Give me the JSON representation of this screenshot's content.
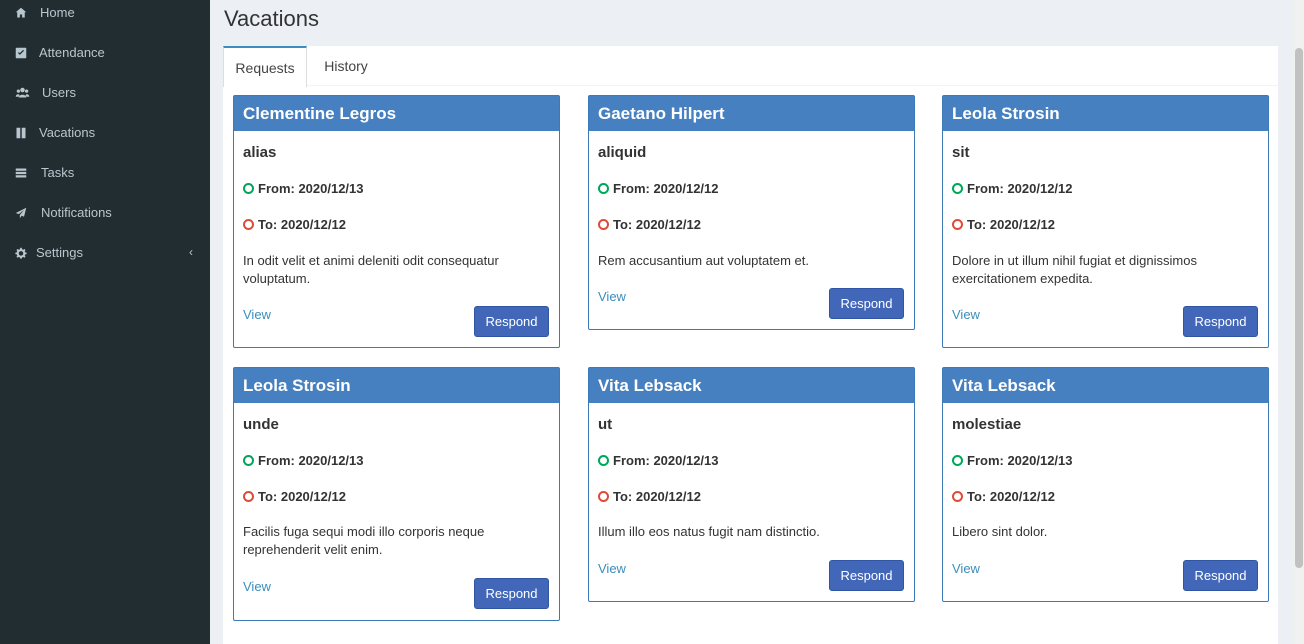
{
  "sidebar": {
    "items": [
      {
        "label": "Home",
        "icon": "home-icon"
      },
      {
        "label": "Attendance",
        "icon": "check-square-icon"
      },
      {
        "label": "Users",
        "icon": "users-icon"
      },
      {
        "label": "Vacations",
        "icon": "columns-icon"
      },
      {
        "label": "Tasks",
        "icon": "tasks-icon"
      },
      {
        "label": "Notifications",
        "icon": "paper-plane-icon"
      },
      {
        "label": "Settings",
        "icon": "gear-icon",
        "chevron": "‹"
      }
    ]
  },
  "page": {
    "title": "Vacations"
  },
  "tabs": [
    {
      "label": "Requests",
      "active": true
    },
    {
      "label": "History",
      "active": false
    }
  ],
  "cards": [
    {
      "name": "Clementine Legros",
      "subject": "alias",
      "from": "From: 2020/12/13",
      "to": "To: 2020/12/12",
      "description": "In odit velit et animi deleniti odit consequatur voluptatum.",
      "view": "View",
      "respond": "Respond"
    },
    {
      "name": "Gaetano Hilpert",
      "subject": "aliquid",
      "from": "From: 2020/12/12",
      "to": "To: 2020/12/12",
      "description": "Rem accusantium aut voluptatem et.",
      "view": "View",
      "respond": "Respond"
    },
    {
      "name": "Leola Strosin",
      "subject": "sit",
      "from": "From: 2020/12/12",
      "to": "To: 2020/12/12",
      "description": "Dolore in ut illum nihil fugiat et dignissimos exercitationem expedita.",
      "view": "View",
      "respond": "Respond"
    },
    {
      "name": "Leola Strosin",
      "subject": "unde",
      "from": "From: 2020/12/13",
      "to": "To: 2020/12/12",
      "description": "Facilis fuga sequi modi illo corporis neque reprehenderit velit enim.",
      "view": "View",
      "respond": "Respond"
    },
    {
      "name": "Vita Lebsack",
      "subject": "ut",
      "from": "From: 2020/12/13",
      "to": "To: 2020/12/12",
      "description": "Illum illo eos natus fugit nam distinctio.",
      "view": "View",
      "respond": "Respond"
    },
    {
      "name": "Vita Lebsack",
      "subject": "molestiae",
      "from": "From: 2020/12/13",
      "to": "To: 2020/12/12",
      "description": "Libero sint dolor.",
      "view": "View",
      "respond": "Respond"
    }
  ],
  "colors": {
    "sidebar_bg": "#222d32",
    "card_header": "#4780c0",
    "respond_button": "#4267b8",
    "from_indicator": "#00a65a",
    "to_indicator": "#dd4b39",
    "link": "#3c8dbc"
  }
}
